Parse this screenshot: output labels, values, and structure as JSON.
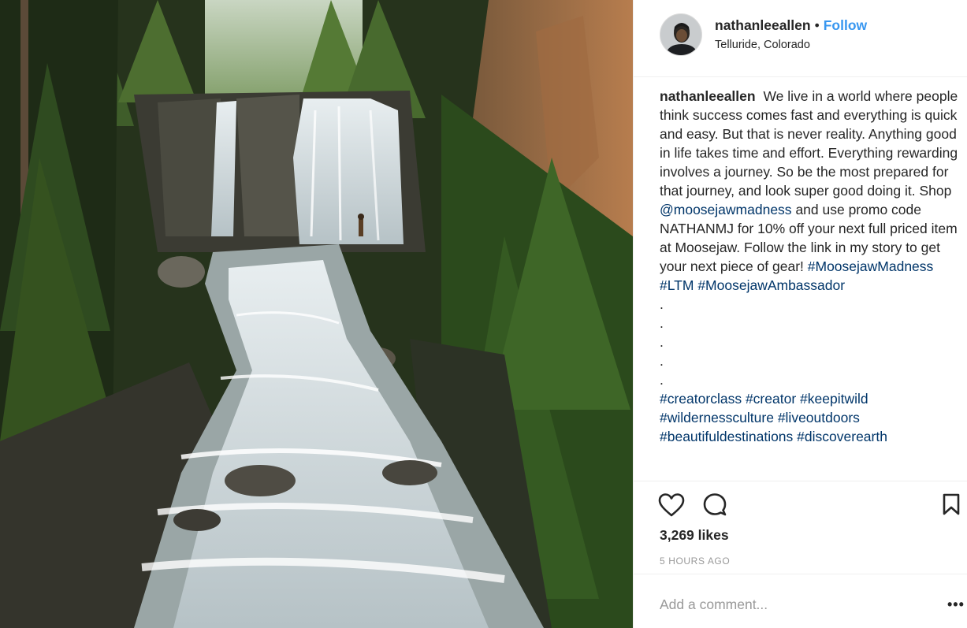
{
  "photo": {
    "subject": "waterfall-photo"
  },
  "header": {
    "username": "nathanleeallen",
    "separator": "•",
    "follow_label": "Follow",
    "location": "Telluride, Colorado"
  },
  "caption": {
    "username": "nathanleeallen",
    "text_1": "We live in a world where people think success comes fast and everything is quick and easy. But that is never reality. Anything good in life takes time and effort. Everything rewarding involves a journey. So be the most prepared for that journey, and look super good doing it. Shop",
    "mention": "@moosejawmadness",
    "text_2": "and use promo code NATHANMJ for 10% off your next full priced item at Moosejaw. Follow the link in my story to get your next piece of gear!",
    "hashtags_1": [
      "#MoosejawMadness",
      "#LTM",
      "#MoosejawAmbassador"
    ],
    "dots": [
      ".",
      ".",
      ".",
      ".",
      "."
    ],
    "hashtags_2": [
      "#creatorclass",
      "#creator",
      "#keepitwild",
      "#wildernessculture",
      "#liveoutdoors",
      "#beautifuldestinations",
      "#discoverearth"
    ]
  },
  "actions": {
    "likes": "3,269 likes",
    "timestamp": "5 HOURS AGO",
    "comment_placeholder": "Add a comment...",
    "more_label": "•••"
  },
  "colors": {
    "follow": "#3897f0",
    "link": "#003569",
    "muted": "#999999",
    "text": "#262626"
  }
}
